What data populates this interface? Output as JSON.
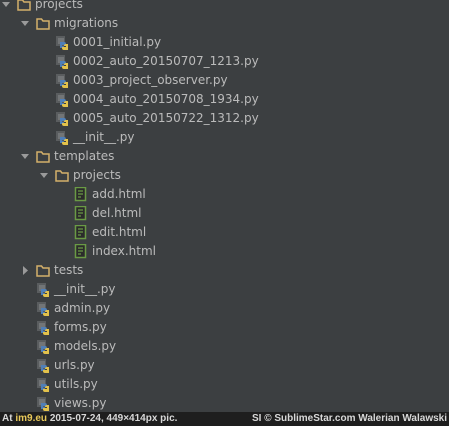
{
  "tree": [
    {
      "label": "projects",
      "type": "folder",
      "depth": 0,
      "expanded": true
    },
    {
      "label": "migrations",
      "type": "folder",
      "depth": 1,
      "expanded": true
    },
    {
      "label": "0001_initial.py",
      "type": "py",
      "depth": 2
    },
    {
      "label": "0002_auto_20150707_1213.py",
      "type": "py",
      "depth": 2
    },
    {
      "label": "0003_project_observer.py",
      "type": "py",
      "depth": 2
    },
    {
      "label": "0004_auto_20150708_1934.py",
      "type": "py",
      "depth": 2
    },
    {
      "label": "0005_auto_20150722_1312.py",
      "type": "py",
      "depth": 2
    },
    {
      "label": "__init__.py",
      "type": "py",
      "depth": 2
    },
    {
      "label": "templates",
      "type": "folder",
      "depth": 1,
      "expanded": true
    },
    {
      "label": "projects",
      "type": "folder",
      "depth": 2,
      "expanded": true
    },
    {
      "label": "add.html",
      "type": "html",
      "depth": 3
    },
    {
      "label": "del.html",
      "type": "html",
      "depth": 3
    },
    {
      "label": "edit.html",
      "type": "html",
      "depth": 3
    },
    {
      "label": "index.html",
      "type": "html",
      "depth": 3
    },
    {
      "label": "tests",
      "type": "folder",
      "depth": 1,
      "expanded": false
    },
    {
      "label": "__init__.py",
      "type": "py",
      "depth": 1
    },
    {
      "label": "admin.py",
      "type": "py",
      "depth": 1
    },
    {
      "label": "forms.py",
      "type": "py",
      "depth": 1
    },
    {
      "label": "models.py",
      "type": "py",
      "depth": 1
    },
    {
      "label": "urls.py",
      "type": "py",
      "depth": 1
    },
    {
      "label": "utils.py",
      "type": "py",
      "depth": 1
    },
    {
      "label": "views.py",
      "type": "py",
      "depth": 1
    }
  ],
  "footer": {
    "prefix": "At",
    "site": "im9.eu",
    "info": "2015-07-24, 449×414px pic.",
    "credit": "SI © SublimeStar.com Walerian Walawski"
  },
  "colors": {
    "background": "#3c3f41",
    "text": "#bbbbbb",
    "folder": "#d4b06a",
    "python_blue": "#4f7fb8",
    "python_yellow": "#e3c24b",
    "html_file": "#6a9a45",
    "footer_bg": "#1e1e1e"
  }
}
